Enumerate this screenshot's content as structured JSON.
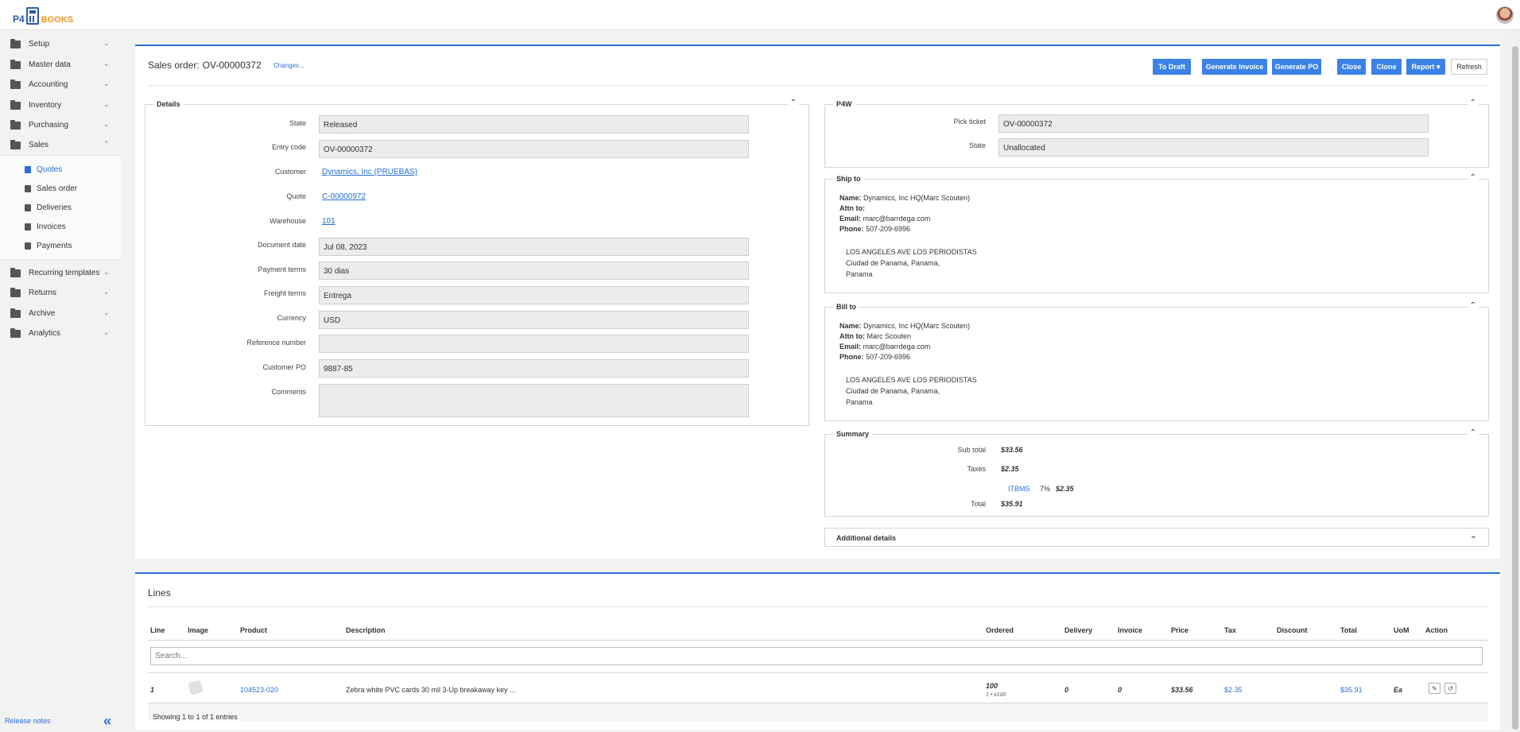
{
  "brand": {
    "prefix": "P4",
    "name": "BOOKS"
  },
  "sidebar": {
    "items": [
      {
        "label": "Setup",
        "chev": "⌄"
      },
      {
        "label": "Master data",
        "chev": "⌄"
      },
      {
        "label": "Accounting",
        "chev": "⌄"
      },
      {
        "label": "Inventory",
        "chev": "⌄"
      },
      {
        "label": "Purchasing",
        "chev": "⌄"
      },
      {
        "label": "Sales",
        "chev": "⌃"
      }
    ],
    "sales_sub": [
      {
        "label": "Quotes",
        "icon": "file-icon"
      },
      {
        "label": "Sales order",
        "icon": "cart-icon"
      },
      {
        "label": "Deliveries",
        "icon": "truck-icon"
      },
      {
        "label": "Invoices",
        "icon": "invoice-icon"
      },
      {
        "label": "Payments",
        "icon": "card-icon"
      }
    ],
    "items_after": [
      {
        "label": "Recurring templates",
        "chev": "⌄"
      },
      {
        "label": "Returns",
        "chev": "⌄"
      },
      {
        "label": "Archive",
        "chev": "⌄"
      },
      {
        "label": "Analytics",
        "chev": "⌄"
      }
    ],
    "release_notes": "Release notes",
    "collapse": "«"
  },
  "header": {
    "title": "Sales order:",
    "number": "OV-00000372",
    "changes_link": "Changes...",
    "buttons": {
      "to_draft": "To Draft",
      "generate_invoice": "Generate Invoice",
      "generate_po": "Generate PO",
      "close": "Close",
      "clone": "Clone",
      "report": "Report ▾",
      "refresh": "Refresh"
    }
  },
  "details": {
    "legend": "Details",
    "caret": "⌃",
    "fields": {
      "state": {
        "label": "State",
        "value": "Released"
      },
      "entry_code": {
        "label": "Entry code",
        "value": "OV-00000372"
      },
      "customer": {
        "label": "Customer",
        "value": "Dynamics, Inc (PRUEBAS)"
      },
      "quote": {
        "label": "Quote",
        "value": "C-00000972"
      },
      "warehouse": {
        "label": "Warehouse",
        "value": "101"
      },
      "document_date": {
        "label": "Document date",
        "value": "Jul 08, 2023"
      },
      "payment_terms": {
        "label": "Payment terms",
        "value": "30 dias"
      },
      "freight_terms": {
        "label": "Freight terms",
        "value": "Entrega"
      },
      "currency": {
        "label": "Currency",
        "value": "USD"
      },
      "reference_number": {
        "label": "Reference number",
        "value": ""
      },
      "customer_po": {
        "label": "Customer PO",
        "value": "9887-85"
      },
      "comments": {
        "label": "Comments",
        "value": ""
      }
    }
  },
  "p4w": {
    "legend": "P4W",
    "caret": "⌃",
    "pick_ticket": {
      "label": "Pick ticket",
      "value": "OV-00000372"
    },
    "state": {
      "label": "State",
      "value": "Unallocated"
    }
  },
  "ship_to": {
    "legend": "Ship to",
    "caret": "⌃",
    "name_label": "Name:",
    "name": "Dynamics, Inc HQ(Marc Scouten)",
    "attn_label": "Attn to:",
    "attn": "",
    "email_label": "Email:",
    "email": "marc@barrdega.com",
    "phone_label": "Phone:",
    "phone": "507-209-6996",
    "addr1": "LOS ANGELES AVE LOS PERIODISTAS",
    "addr2": "Ciudad de Panama, Panama,",
    "addr3": "Panama"
  },
  "bill_to": {
    "legend": "Bill to",
    "caret": "⌃",
    "name_label": "Name:",
    "name": "Dynamics, Inc HQ(Marc Scouten)",
    "attn_label": "Attn to:",
    "attn": "Marc Scouten",
    "email_label": "Email:",
    "email": "marc@barrdega.com",
    "phone_label": "Phone:",
    "phone": "507-209-6996",
    "addr1": "LOS ANGELES AVE LOS PERIODISTAS",
    "addr2": "Ciudad de Panama, Panama,",
    "addr3": "Panama"
  },
  "summary": {
    "legend": "Summary",
    "caret": "⌃",
    "subtotal_label": "Sub total",
    "subtotal": "$33.56",
    "taxes_label": "Taxes",
    "taxes": "$2.35",
    "tax_name": "ITBMS",
    "tax_rate": "7%",
    "tax_amount": "$2.35",
    "total_label": "Total",
    "total": "$35.91"
  },
  "additional": {
    "label": "Additional details",
    "caret": "⌄"
  },
  "lines": {
    "title": "Lines",
    "columns": [
      "Line",
      "Image",
      "Product",
      "Description",
      "Ordered",
      "Delivery",
      "Invoice",
      "Price",
      "Tax",
      "Discount",
      "Total",
      "UoM",
      "Action"
    ],
    "search_placeholder": "Search...",
    "rows": [
      {
        "line": "1",
        "product": "104523-020",
        "description": "Zebra white PVC cards 30 mil 3-Up breakaway key ...",
        "ordered": "100",
        "ordered_sub": "1 • x100",
        "delivery": "0",
        "invoice": "0",
        "price": "$33.56",
        "tax": "$2.35",
        "discount": "",
        "total": "$35.91",
        "uom": "Ea"
      }
    ],
    "footer": "Showing 1 to 1 of 1 entries"
  }
}
